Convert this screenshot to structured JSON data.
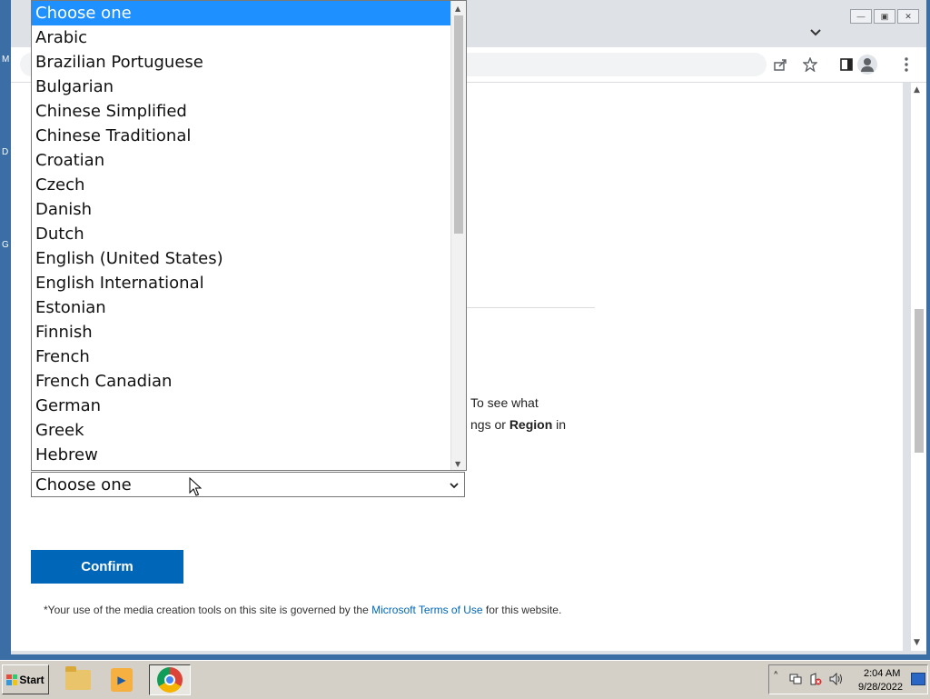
{
  "desktop": {
    "labels": [
      "M",
      "D",
      "G"
    ]
  },
  "window": {
    "controls": {
      "minimize": "—",
      "restore": "▣",
      "close": "✕"
    },
    "tab_search_icon": "chevron-down-icon"
  },
  "toolbar": {
    "icons": [
      "share-icon",
      "star-icon",
      "side-panel-icon",
      "profile-icon",
      "menu-icon"
    ]
  },
  "page": {
    "body_text_line1": "To see what",
    "body_text_line2_prefix": "ngs or ",
    "body_text_line2_bold": "Region",
    "body_text_line2_suffix": " in",
    "select": {
      "selected": "Choose one"
    },
    "confirm_label": "Confirm",
    "terms": {
      "prefix": "*Your use of the media creation tools on this site is governed by the ",
      "link": "Microsoft Terms of Use",
      "suffix": " for this website."
    }
  },
  "dropdown": {
    "options": [
      "Choose one",
      "Arabic",
      "Brazilian Portuguese",
      "Bulgarian",
      "Chinese Simplified",
      "Chinese Traditional",
      "Croatian",
      "Czech",
      "Danish",
      "Dutch",
      "English (United States)",
      "English International",
      "Estonian",
      "Finnish",
      "French",
      "French Canadian",
      "German",
      "Greek",
      "Hebrew"
    ],
    "highlighted": "Choose one"
  },
  "taskbar": {
    "start_label": "Start",
    "pinned": [
      "folder-icon",
      "media-player-icon",
      "chrome-icon"
    ],
    "clock_time": "2:04 AM",
    "clock_date": "9/28/2022"
  }
}
